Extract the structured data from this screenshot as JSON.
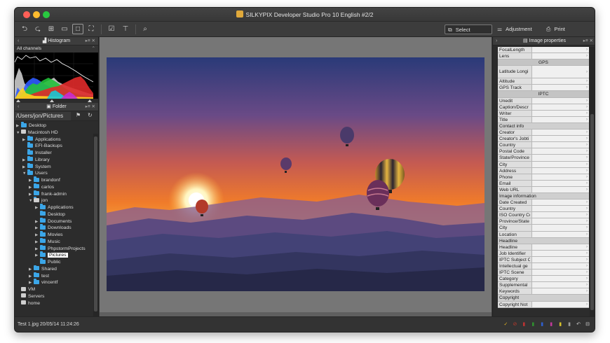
{
  "window": {
    "title": "SILKYPIX Developer Studio Pro 10 English   #2/2"
  },
  "toolbar": {
    "select_label": "Select",
    "adjustment_label": "Adjustment",
    "print_label": "Print"
  },
  "histogram_panel": {
    "title": "Histogram",
    "channel": "All channels"
  },
  "folder_panel": {
    "title": "Folder",
    "path": "/Users/jon/Pictures",
    "tree": [
      {
        "label": "Desktop",
        "depth": 0,
        "arrow": "▶",
        "icon": "folder"
      },
      {
        "label": "Macintosh HD",
        "depth": 0,
        "arrow": "▼",
        "icon": "drive"
      },
      {
        "label": "Applications",
        "depth": 1,
        "arrow": "▶",
        "icon": "folder"
      },
      {
        "label": "EFI-Backups",
        "depth": 1,
        "arrow": "",
        "icon": "folder"
      },
      {
        "label": "Installer",
        "depth": 1,
        "arrow": "",
        "icon": "folder"
      },
      {
        "label": "Library",
        "depth": 1,
        "arrow": "▶",
        "icon": "folder"
      },
      {
        "label": "System",
        "depth": 1,
        "arrow": "▶",
        "icon": "folder"
      },
      {
        "label": "Users",
        "depth": 1,
        "arrow": "▼",
        "icon": "folder"
      },
      {
        "label": "brandonf",
        "depth": 2,
        "arrow": "▶",
        "icon": "folder"
      },
      {
        "label": "carlos",
        "depth": 2,
        "arrow": "▶",
        "icon": "folder"
      },
      {
        "label": "frank-admin",
        "depth": 2,
        "arrow": "▶",
        "icon": "folder"
      },
      {
        "label": "jon",
        "depth": 2,
        "arrow": "▼",
        "icon": "home"
      },
      {
        "label": "Applications",
        "depth": 3,
        "arrow": "▶",
        "icon": "folder"
      },
      {
        "label": "Desktop",
        "depth": 3,
        "arrow": "",
        "icon": "folder"
      },
      {
        "label": "Documents",
        "depth": 3,
        "arrow": "▶",
        "icon": "folder"
      },
      {
        "label": "Downloads",
        "depth": 3,
        "arrow": "▶",
        "icon": "folder"
      },
      {
        "label": "Movies",
        "depth": 3,
        "arrow": "▶",
        "icon": "folder"
      },
      {
        "label": "Music",
        "depth": 3,
        "arrow": "▶",
        "icon": "folder"
      },
      {
        "label": "PhpstormProjects",
        "depth": 3,
        "arrow": "▶",
        "icon": "folder"
      },
      {
        "label": "Pictures",
        "depth": 3,
        "arrow": "▶",
        "icon": "folder",
        "selected": true
      },
      {
        "label": "Public",
        "depth": 3,
        "arrow": "",
        "icon": "folder"
      },
      {
        "label": "Shared",
        "depth": 2,
        "arrow": "▶",
        "icon": "folder"
      },
      {
        "label": "test",
        "depth": 2,
        "arrow": "▶",
        "icon": "folder"
      },
      {
        "label": "vincentf",
        "depth": 2,
        "arrow": "▶",
        "icon": "folder"
      },
      {
        "label": "VM",
        "depth": 0,
        "arrow": "",
        "icon": "drive"
      },
      {
        "label": "Servers",
        "depth": 0,
        "arrow": "",
        "icon": "drive"
      },
      {
        "label": "home",
        "depth": 0,
        "arrow": "",
        "icon": "drive"
      }
    ]
  },
  "properties_panel": {
    "title": "Image properties",
    "rows": [
      {
        "type": "field",
        "label": "FocalLength"
      },
      {
        "type": "field",
        "label": "Lens"
      },
      {
        "type": "section",
        "label": "GPS"
      },
      {
        "type": "tall",
        "label": "Latitude Longi"
      },
      {
        "type": "field",
        "label": "Altitude"
      },
      {
        "type": "field",
        "label": "GPS Track"
      },
      {
        "type": "section",
        "label": "IPTC"
      },
      {
        "type": "field",
        "label": "Unedit"
      },
      {
        "type": "field",
        "label": "Caption/Descr"
      },
      {
        "type": "field",
        "label": "Writer"
      },
      {
        "type": "field",
        "label": "Title"
      },
      {
        "type": "group",
        "label": "Contact info"
      },
      {
        "type": "field",
        "label": "Creator"
      },
      {
        "type": "field",
        "label": "Creator's Jobti"
      },
      {
        "type": "field",
        "label": "Country"
      },
      {
        "type": "field",
        "label": "Postal Code"
      },
      {
        "type": "field",
        "label": "State/Province"
      },
      {
        "type": "field",
        "label": "City"
      },
      {
        "type": "field",
        "label": "Address"
      },
      {
        "type": "field",
        "label": "Phone"
      },
      {
        "type": "field",
        "label": "Email"
      },
      {
        "type": "field",
        "label": "Web URL"
      },
      {
        "type": "group",
        "label": "Image information"
      },
      {
        "type": "field",
        "label": "Date Created"
      },
      {
        "type": "field",
        "label": "Country"
      },
      {
        "type": "field",
        "label": "ISO Country Co"
      },
      {
        "type": "field",
        "label": "Province/State"
      },
      {
        "type": "field",
        "label": "City"
      },
      {
        "type": "field",
        "label": "Location"
      },
      {
        "type": "group",
        "label": "Headline"
      },
      {
        "type": "field",
        "label": "Headline"
      },
      {
        "type": "field",
        "label": "Job Identifier"
      },
      {
        "type": "field",
        "label": "IPTC Subject C"
      },
      {
        "type": "field",
        "label": "Intellectual ge"
      },
      {
        "type": "field",
        "label": "IPTC Scene"
      },
      {
        "type": "field",
        "label": "Category"
      },
      {
        "type": "field",
        "label": "Supplemental"
      },
      {
        "type": "field",
        "label": "Keywords"
      },
      {
        "type": "group",
        "label": "Copyright"
      },
      {
        "type": "field",
        "label": "Copyright Not"
      }
    ]
  },
  "status": {
    "file_info": "Test 1.jpg 20/05/14 11:24:26"
  },
  "colors": {
    "accent_folder": "#3ba6e8",
    "window_bg": "#3a3a3a"
  }
}
